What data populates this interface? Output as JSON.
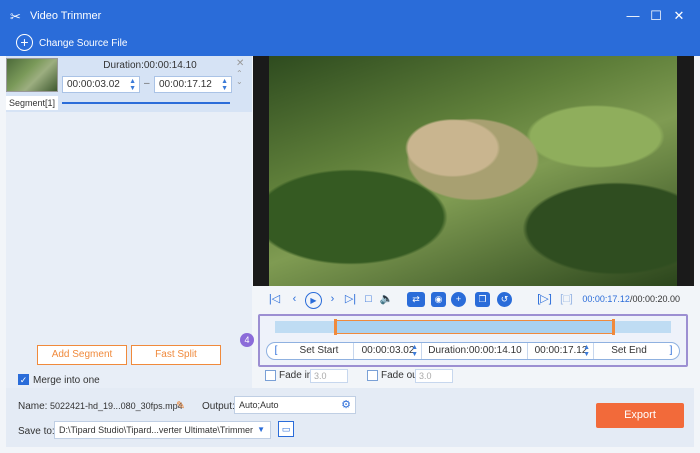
{
  "window": {
    "title": "Video Trimmer",
    "icon": "scissors-icon",
    "minimize_glyph": "—",
    "maximize_glyph": "☐",
    "close_glyph": "✕"
  },
  "toolbar": {
    "change_source": "Change Source File"
  },
  "segment": {
    "label": "Segment[1]",
    "duration": "Duration:00:00:14.10",
    "start": "00:00:03.02",
    "end": "00:00:17.12",
    "separator": "–",
    "progress_percent": 100
  },
  "left_actions": {
    "add_segment": "Add Segment",
    "fast_split": "Fast Split",
    "merge_label": "Merge into one",
    "merge_checked": true
  },
  "playback": {
    "current_time": "00:00:17.12",
    "total_time": "00:00:20.00",
    "separator": "/"
  },
  "trim": {
    "badge": "4",
    "set_start": "Set Start",
    "start_time": "00:00:03.02",
    "duration": "Duration:00:00:14.10",
    "end_time": "00:00:17.12",
    "set_end": "Set End",
    "selection_start_fraction": 0.151,
    "selection_end_fraction": 0.856
  },
  "fade": {
    "fade_in_label": "Fade in",
    "fade_in_value": "3.0",
    "fade_out_label": "Fade out",
    "fade_out_value": "3.0"
  },
  "output": {
    "name_label": "Name:",
    "name_value": "5022421-hd_19...080_30fps.mp4",
    "output_label": "Output:",
    "output_value": "Auto;Auto",
    "save_label": "Save to:",
    "save_value": "D:\\Tipard Studio\\Tipard...verter Ultimate\\Trimmer",
    "export": "Export"
  },
  "colors": {
    "accent": "#2a6cd9",
    "export": "#f26a3a",
    "handle": "#f08a3c",
    "highlight": "#9c8fd2"
  }
}
